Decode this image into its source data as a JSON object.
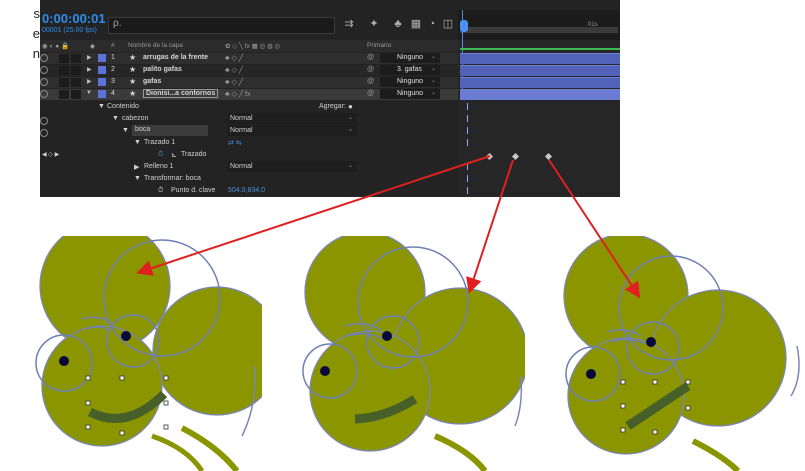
{
  "side_text": [
    "s",
    "e",
    "n"
  ],
  "panel": {
    "timecode": "0:00:00:01",
    "subtime": "00001 (25.00 fps)",
    "search_placeholder": "ρ.",
    "header": {
      "layer_name": "Nombre de la capa",
      "hash": "#",
      "parent": "Primario"
    },
    "layers": [
      {
        "num": "1",
        "name": "arrugas de la frente",
        "parent": "Ninguno"
      },
      {
        "num": "2",
        "name": "palito gafas",
        "parent": "3. gafas"
      },
      {
        "num": "3",
        "name": "gafas",
        "parent": "Ninguno"
      },
      {
        "num": "4",
        "name": "Dionisi...a contornos",
        "parent": "Ninguno"
      }
    ],
    "props": {
      "contenido": "Contenido",
      "agregar": "Agregar:",
      "cabezon": "cabezon",
      "boca": "boca",
      "trazado1": "Trazado 1",
      "trazado": "Trazado",
      "relleno1": "Relleno 1",
      "transformar": "Transformar: boca",
      "punto_clave": "Punto d. clave",
      "punto_clave_val": "504.0,834.0",
      "mode_normal": "Normal"
    },
    "timeline": {
      "marker_label": "01s"
    }
  },
  "colors": {
    "panel_bg": "#232323",
    "accent_blue": "#2d8ceb",
    "layer_bar": "#5262b8",
    "head_fill": "#8a9500",
    "arrow": "#e02020"
  }
}
